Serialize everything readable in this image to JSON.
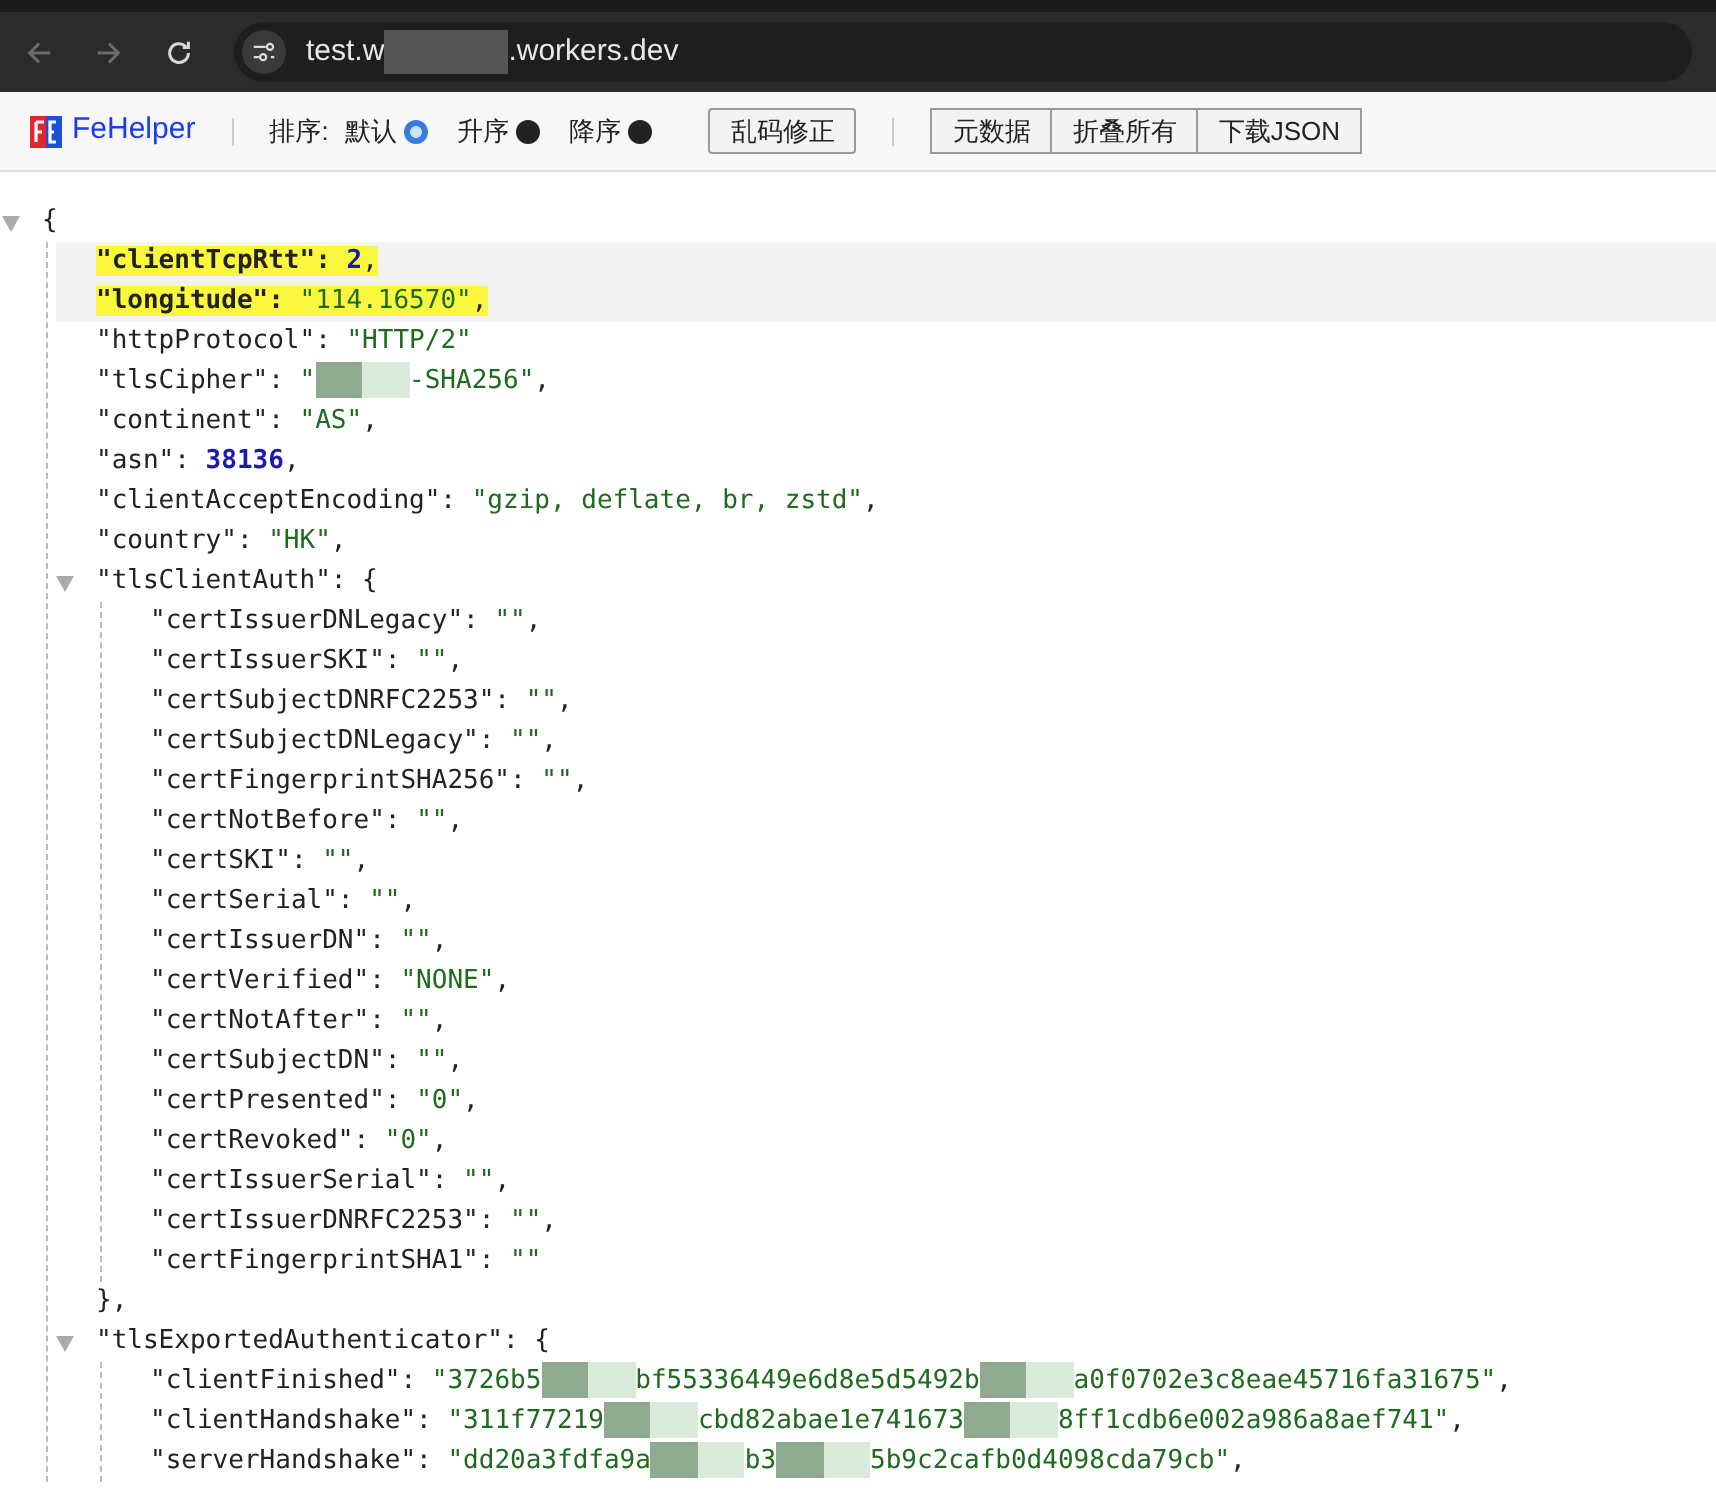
{
  "browser": {
    "back_disabled": true,
    "forward_disabled": true,
    "url_parts": [
      "test.w",
      ".workers.dev"
    ]
  },
  "toolbar": {
    "brand": "FeHelper",
    "sort_label": "排序:",
    "sort_options": [
      {
        "label": "默认",
        "selected": true
      },
      {
        "label": "升序",
        "selected": false
      },
      {
        "label": "降序",
        "selected": false
      }
    ],
    "fix_button": "乱码修正",
    "buttons": [
      "元数据",
      "折叠所有",
      "下载JSON"
    ]
  },
  "json": {
    "open": "{",
    "expanded": true,
    "children": [
      {
        "key": "\"clientTcpRtt\": ",
        "value": [
          "2"
        ],
        "kind": "number",
        "tail": ",",
        "highlighted": true
      },
      {
        "key": "\"longitude\": ",
        "value": [
          "\"114.16570\""
        ],
        "kind": "string",
        "tail": ",",
        "highlighted": true
      },
      {
        "key": "\"httpProtocol\": ",
        "value": [
          "\"HTTP/2\""
        ],
        "kind": "string",
        "highlighted": false
      },
      {
        "key": "\"tlsCipher\": ",
        "value": [
          "\"",
          "-SHA256\""
        ],
        "kind": "string",
        "tail": ",",
        "highlighted": false
      },
      {
        "key": "\"continent\": ",
        "value": [
          "\"AS\""
        ],
        "kind": "string",
        "tail": ",",
        "highlighted": false
      },
      {
        "key": "\"asn\": ",
        "value": [
          "38136"
        ],
        "kind": "number",
        "tail": ",",
        "highlighted": false
      },
      {
        "key": "\"clientAcceptEncoding\": ",
        "value": [
          "\"gzip, deflate, br, zstd\""
        ],
        "kind": "string",
        "tail": ",",
        "highlighted": false
      },
      {
        "key": "\"country\": ",
        "value": [
          "\"HK\""
        ],
        "kind": "string",
        "tail": ",",
        "highlighted": false
      },
      {
        "key": "\"tlsClientAuth\": ",
        "open": "{",
        "close": "},",
        "expanded": true,
        "children": [
          {
            "key": "\"certIssuerDNLegacy\": ",
            "value": [
              "\"\""
            ],
            "kind": "string",
            "tail": ",",
            "highlighted": false
          },
          {
            "key": "\"certIssuerSKI\": ",
            "value": [
              "\"\""
            ],
            "kind": "string",
            "tail": ",",
            "highlighted": false
          },
          {
            "key": "\"certSubjectDNRFC2253\": ",
            "value": [
              "\"\""
            ],
            "kind": "string",
            "tail": ",",
            "highlighted": false
          },
          {
            "key": "\"certSubjectDNLegacy\": ",
            "value": [
              "\"\""
            ],
            "kind": "string",
            "tail": ",",
            "highlighted": false
          },
          {
            "key": "\"certFingerprintSHA256\": ",
            "value": [
              "\"\""
            ],
            "kind": "string",
            "tail": ",",
            "highlighted": false
          },
          {
            "key": "\"certNotBefore\": ",
            "value": [
              "\"\""
            ],
            "kind": "string",
            "tail": ",",
            "highlighted": false
          },
          {
            "key": "\"certSKI\": ",
            "value": [
              "\"\""
            ],
            "kind": "string",
            "tail": ",",
            "highlighted": false
          },
          {
            "key": "\"certSerial\": ",
            "value": [
              "\"\""
            ],
            "kind": "string",
            "tail": ",",
            "highlighted": false
          },
          {
            "key": "\"certIssuerDN\": ",
            "value": [
              "\"\""
            ],
            "kind": "string",
            "tail": ",",
            "highlighted": false
          },
          {
            "key": "\"certVerified\": ",
            "value": [
              "\"NONE\""
            ],
            "kind": "string",
            "tail": ",",
            "highlighted": false
          },
          {
            "key": "\"certNotAfter\": ",
            "value": [
              "\"\""
            ],
            "kind": "string",
            "tail": ",",
            "highlighted": false
          },
          {
            "key": "\"certSubjectDN\": ",
            "value": [
              "\"\""
            ],
            "kind": "string",
            "tail": ",",
            "highlighted": false
          },
          {
            "key": "\"certPresented\": ",
            "value": [
              "\"0\""
            ],
            "kind": "string",
            "tail": ",",
            "highlighted": false
          },
          {
            "key": "\"certRevoked\": ",
            "value": [
              "\"0\""
            ],
            "kind": "string",
            "tail": ",",
            "highlighted": false
          },
          {
            "key": "\"certIssuerSerial\": ",
            "value": [
              "\"\""
            ],
            "kind": "string",
            "tail": ",",
            "highlighted": false
          },
          {
            "key": "\"certIssuerDNRFC2253\": ",
            "value": [
              "\"\""
            ],
            "kind": "string",
            "tail": ",",
            "highlighted": false
          },
          {
            "key": "\"certFingerprintSHA1\": ",
            "value": [
              "\"\""
            ],
            "kind": "string",
            "highlighted": false
          }
        ]
      },
      {
        "key": "\"tlsExportedAuthenticator\": ",
        "open": "{",
        "expanded": true,
        "children": [
          {
            "key": "\"clientFinished\": ",
            "value": [
              "\"3726b5",
              "bf55336449e6d8e5d5492b",
              "a0f0702e3c8eae45716fa31675\""
            ],
            "kind": "string",
            "tail": ",",
            "highlighted": false
          },
          {
            "key": "\"clientHandshake\": ",
            "value": [
              "\"311f77219",
              "cbd82abae1e741673",
              "8ff1cdb6e002a986a8aef741\""
            ],
            "kind": "string",
            "tail": ",",
            "highlighted": false
          },
          {
            "key": "\"serverHandshake\": ",
            "value": [
              "\"dd20a3fdfa9a",
              "b3",
              "5b9c2cafb0d4098cda79cb\""
            ],
            "kind": "string",
            "tail": ",",
            "highlighted": false
          }
        ]
      }
    ]
  }
}
